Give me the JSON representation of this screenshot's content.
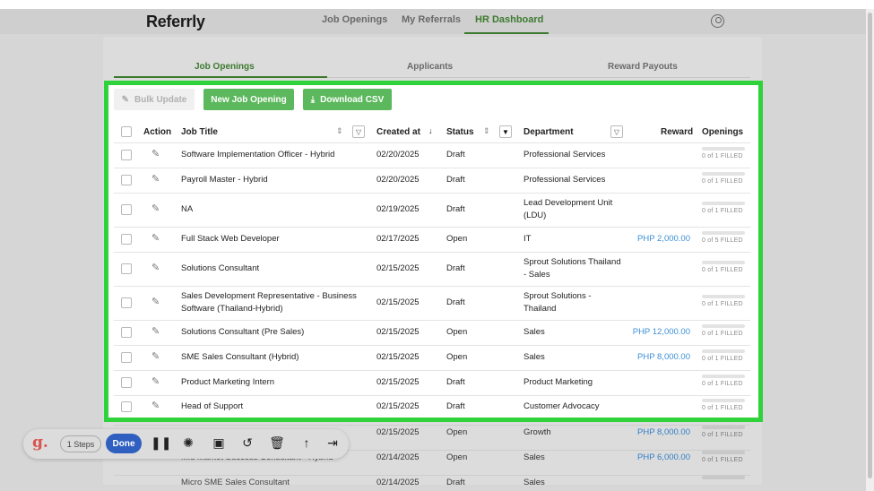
{
  "brand": "Referrly",
  "nav": [
    "Job Openings",
    "My Referrals",
    "HR Dashboard"
  ],
  "subtabs": [
    "Job Openings",
    "Applicants",
    "Reward Payouts"
  ],
  "actions": {
    "bulk": "Bulk Update",
    "new": "New Job Opening",
    "csv": "Download CSV"
  },
  "headers": {
    "action": "Action",
    "title": "Job Title",
    "created": "Created at",
    "status": "Status",
    "department": "Department",
    "reward": "Reward",
    "openings": "Openings"
  },
  "rows": [
    {
      "title": [
        "Software Implementation Officer - Hybrid"
      ],
      "created": "02/20/2025",
      "status": "Draft",
      "department": [
        "Professional Services"
      ],
      "reward": "",
      "filled": "0 of 1 FILLED"
    },
    {
      "title": [
        "Payroll Master - Hybrid"
      ],
      "created": "02/20/2025",
      "status": "Draft",
      "department": [
        "Professional Services"
      ],
      "reward": "",
      "filled": "0 of 1 FILLED"
    },
    {
      "title": [
        "NA"
      ],
      "created": "02/19/2025",
      "status": "Draft",
      "department": [
        "Lead Development Unit",
        "(LDU)"
      ],
      "reward": "",
      "filled": "0 of 1 FILLED"
    },
    {
      "title": [
        "Full Stack Web Developer"
      ],
      "created": "02/17/2025",
      "status": "Open",
      "department": [
        "IT"
      ],
      "reward": "PHP 2,000.00",
      "filled": "0 of 5 FILLED"
    },
    {
      "title": [
        "Solutions Consultant"
      ],
      "created": "02/15/2025",
      "status": "Draft",
      "department": [
        "Sprout Solutions Thailand",
        "- Sales"
      ],
      "reward": "",
      "filled": "0 of 1 FILLED"
    },
    {
      "title": [
        "Sales Development Representative - Business",
        "Software (Thailand-Hybrid)"
      ],
      "created": "02/15/2025",
      "status": "Draft",
      "department": [
        "Sprout Solutions -",
        "Thailand"
      ],
      "reward": "",
      "filled": "0 of 1 FILLED"
    },
    {
      "title": [
        "Solutions Consultant (Pre Sales)"
      ],
      "created": "02/15/2025",
      "status": "Open",
      "department": [
        "Sales"
      ],
      "reward": "PHP 12,000.00",
      "filled": "0 of 1 FILLED"
    },
    {
      "title": [
        "SME Sales Consultant (Hybrid)"
      ],
      "created": "02/15/2025",
      "status": "Open",
      "department": [
        "Sales"
      ],
      "reward": "PHP 8,000.00",
      "filled": "0 of 1 FILLED"
    },
    {
      "title": [
        "Product Marketing Intern"
      ],
      "created": "02/15/2025",
      "status": "Draft",
      "department": [
        "Product Marketing"
      ],
      "reward": "",
      "filled": "0 of 1 FILLED"
    },
    {
      "title": [
        "Head of Support"
      ],
      "created": "02/15/2025",
      "status": "Draft",
      "department": [
        "Customer Advocacy"
      ],
      "reward": "",
      "filled": "0 of 1 FILLED"
    }
  ],
  "rows_below": [
    {
      "title": "",
      "created": "02/15/2025",
      "status": "Open",
      "department": "Growth",
      "reward": "PHP 8,000.00",
      "filled": "0 of 1 FILLED"
    },
    {
      "title": "Mid Market Success Consultant - Hybrid",
      "created": "02/14/2025",
      "status": "Open",
      "department": "Sales",
      "reward": "PHP 6,000.00",
      "filled": "0 of 1 FILLED"
    },
    {
      "title": "Micro SME Sales Consultant",
      "created": "02/14/2025",
      "status": "Draft",
      "department": "Sales",
      "reward": "",
      "filled": ""
    }
  ],
  "toolbar": {
    "logo": "g.",
    "steps": "1 Steps",
    "done": "Done"
  },
  "icons": [
    "pause-icon",
    "blur-icon",
    "image-icon",
    "undo-icon",
    "delete-icon",
    "share-icon",
    "skip-end-icon"
  ],
  "colors": {
    "accent": "#5cb85c",
    "highlight": "#2fd23a",
    "reward": "#3c8fd6",
    "done": "#2f5fbf"
  }
}
